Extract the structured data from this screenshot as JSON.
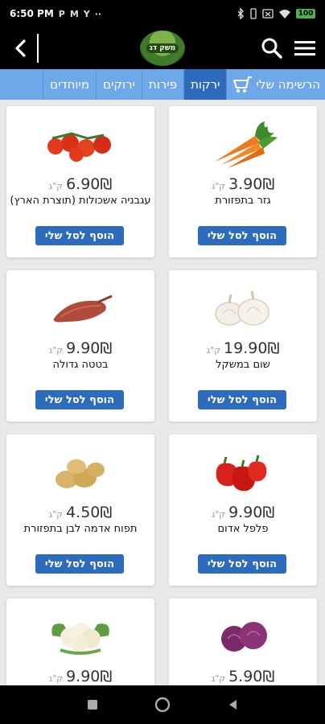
{
  "status": {
    "time": "6:50 PM",
    "left_icons": [
      "P",
      "M",
      "Y",
      "··"
    ],
    "battery": "100"
  },
  "header": {
    "logo_text": "משק דג",
    "icons": [
      "back-icon",
      "search-icon",
      "menu-icon"
    ]
  },
  "tabs": [
    {
      "label": "הרשימה שלי",
      "icon": "cart-icon"
    },
    {
      "label": "ירקות",
      "active": true
    },
    {
      "label": "פירות"
    },
    {
      "label": "ירוקים"
    },
    {
      "label": "מיוחדים"
    }
  ],
  "products": [
    {
      "name": "גזר בתפזורת",
      "price": "3.90₪",
      "unit": "ק\"ג",
      "button": "הוסף לסל שלי",
      "image": "carrots"
    },
    {
      "name": "עגבניה אשכולות (תוצרת הארץ)",
      "price": "6.90₪",
      "unit": "ק\"ג",
      "button": "הוסף לסל שלי",
      "image": "tomatoes"
    },
    {
      "name": "שום במשקל",
      "price": "19.90₪",
      "unit": "ק\"ג",
      "button": "הוסף לסל שלי",
      "image": "garlic"
    },
    {
      "name": "בטטה גדולה",
      "price": "9.90₪",
      "unit": "ק\"ג",
      "button": "הוסף לסל שלי",
      "image": "sweet-potato"
    },
    {
      "name": "פלפל אדום",
      "price": "9.90₪",
      "unit": "ק\"ג",
      "button": "הוסף לסל שלי",
      "image": "red-pepper"
    },
    {
      "name": "תפוח אדמה לבן בתפזורת",
      "price": "4.50₪",
      "unit": "ק\"ג",
      "button": "הוסף לסל שלי",
      "image": "potatoes"
    },
    {
      "name": "",
      "price": "5.90₪",
      "unit": "ק\"ג",
      "button": "",
      "image": "red-cabbage"
    },
    {
      "name": "",
      "price": "9.90₪",
      "unit": "ק\"ג",
      "button": "",
      "image": "cauliflower"
    }
  ],
  "colors": {
    "tab_bar": "#6fa8e8",
    "tab_active": "#2d6bbd",
    "button": "#2d6bbd",
    "header": "#000000",
    "page_bg": "#e9e9e9"
  }
}
